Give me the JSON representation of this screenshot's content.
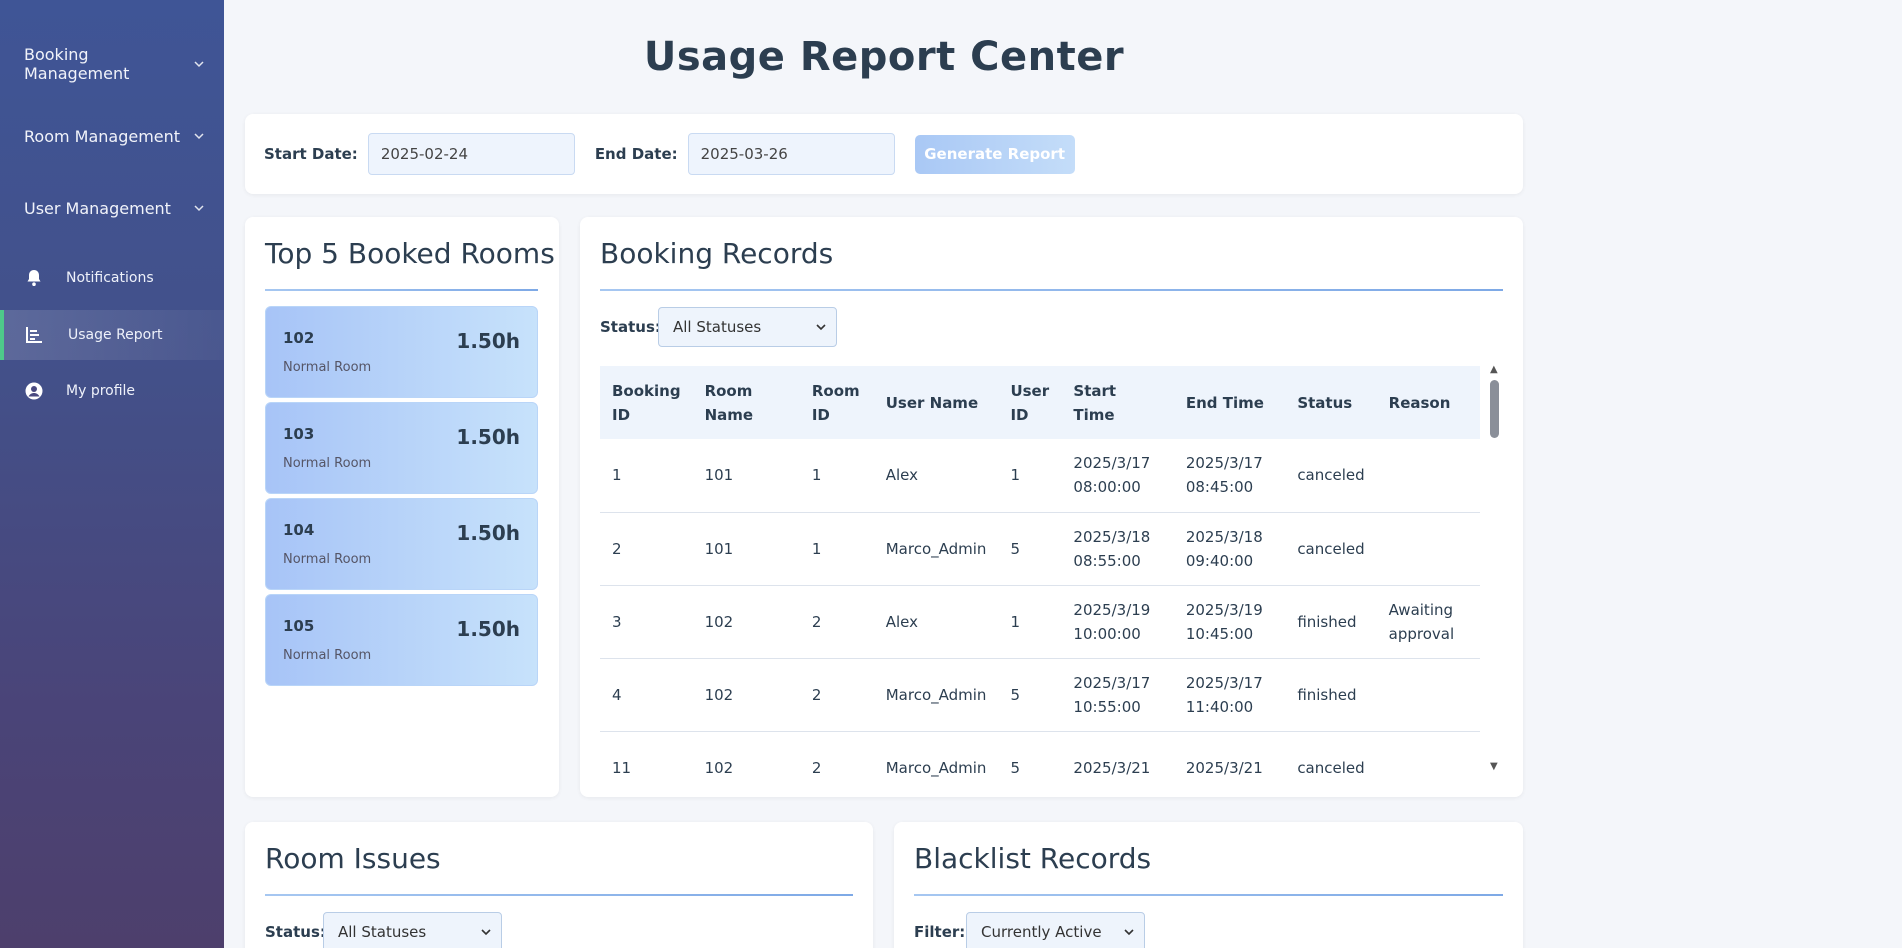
{
  "sidebar": {
    "groups": [
      {
        "label": "Booking Management",
        "chevron": "chevron-down-icon"
      },
      {
        "label": "Room Management",
        "chevron": "chevron-down-icon"
      },
      {
        "label": "User Management",
        "chevron": "chevron-down-icon"
      }
    ],
    "items": [
      {
        "label": "Notifications",
        "icon": "bell-icon",
        "active": false
      },
      {
        "label": "Usage Report",
        "icon": "chart-icon",
        "active": true
      },
      {
        "label": "My profile",
        "icon": "user-circle-icon",
        "active": false
      }
    ],
    "accent_color": "#4ec98a"
  },
  "page": {
    "title": "Usage Report Center"
  },
  "date_filter": {
    "start_label": "Start Date:",
    "start_value": "2025-02-24",
    "end_label": "End Date:",
    "end_value": "2025-03-26",
    "generate_label": "Generate Report"
  },
  "top_rooms": {
    "title": "Top 5 Booked Rooms",
    "rooms": [
      {
        "name": "102",
        "type": "Normal Room",
        "hours": "1.50h"
      },
      {
        "name": "103",
        "type": "Normal Room",
        "hours": "1.50h"
      },
      {
        "name": "104",
        "type": "Normal Room",
        "hours": "1.50h"
      },
      {
        "name": "105",
        "type": "Normal Room",
        "hours": "1.50h"
      }
    ]
  },
  "booking_records": {
    "title": "Booking Records",
    "status_label": "Status:",
    "status_value": "All Statuses",
    "columns": [
      "Booking ID",
      "Room Name",
      "Room ID",
      "User Name",
      "User ID",
      "Start Time",
      "End Time",
      "Status",
      "Reason"
    ],
    "rows": [
      {
        "booking_id": "1",
        "room_name": "101",
        "room_id": "1",
        "user_name": "Alex",
        "user_id": "1",
        "start_date": "2025/3/17",
        "start_time": "08:00:00",
        "end_date": "2025/3/17",
        "end_time": "08:45:00",
        "status": "canceled",
        "reason": ""
      },
      {
        "booking_id": "2",
        "room_name": "101",
        "room_id": "1",
        "user_name": "Marco_Admin",
        "user_id": "5",
        "start_date": "2025/3/18",
        "start_time": "08:55:00",
        "end_date": "2025/3/18",
        "end_time": "09:40:00",
        "status": "canceled",
        "reason": ""
      },
      {
        "booking_id": "3",
        "room_name": "102",
        "room_id": "2",
        "user_name": "Alex",
        "user_id": "1",
        "start_date": "2025/3/19",
        "start_time": "10:00:00",
        "end_date": "2025/3/19",
        "end_time": "10:45:00",
        "status": "finished",
        "reason": "Awaiting approval"
      },
      {
        "booking_id": "4",
        "room_name": "102",
        "room_id": "2",
        "user_name": "Marco_Admin",
        "user_id": "5",
        "start_date": "2025/3/17",
        "start_time": "10:55:00",
        "end_date": "2025/3/17",
        "end_time": "11:40:00",
        "status": "finished",
        "reason": ""
      },
      {
        "booking_id": "11",
        "room_name": "102",
        "room_id": "2",
        "user_name": "Marco_Admin",
        "user_id": "5",
        "start_date": "2025/3/21",
        "start_time": "",
        "end_date": "2025/3/21",
        "end_time": "",
        "status": "canceled",
        "reason": ""
      }
    ]
  },
  "room_issues": {
    "title": "Room Issues",
    "status_label": "Status:",
    "status_value": "All Statuses"
  },
  "blacklist": {
    "title": "Blacklist Records",
    "filter_label": "Filter:",
    "filter_value": "Currently Active"
  }
}
